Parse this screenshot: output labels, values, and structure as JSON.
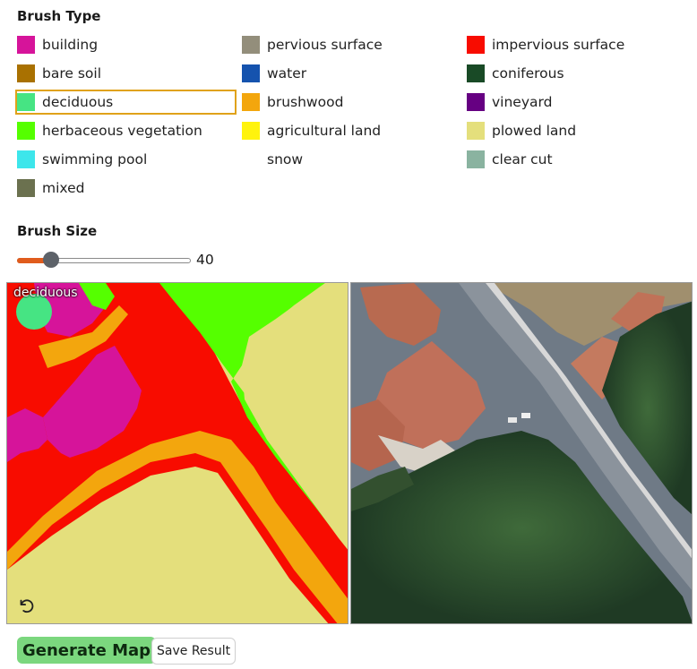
{
  "brush_type": {
    "heading": "Brush Type",
    "selected": "deciduous",
    "items": [
      {
        "label": "building",
        "color": "#d6149a"
      },
      {
        "label": "pervious surface",
        "color": "#938e7b"
      },
      {
        "label": "impervious surface",
        "color": "#f80c00"
      },
      {
        "label": "bare soil",
        "color": "#a97101"
      },
      {
        "label": "water",
        "color": "#1553ae"
      },
      {
        "label": "coniferous",
        "color": "#194a26"
      },
      {
        "label": "deciduous",
        "color": "#46e483"
      },
      {
        "label": "brushwood",
        "color": "#f3a60d"
      },
      {
        "label": "vineyard",
        "color": "#660082"
      },
      {
        "label": "herbaceous vegetation",
        "color": "#55ff00"
      },
      {
        "label": "agricultural land",
        "color": "#fff30d"
      },
      {
        "label": "plowed land",
        "color": "#e4df7c"
      },
      {
        "label": "swimming pool",
        "color": "#3de6eb"
      },
      {
        "label": "snow",
        "color": "#ffffff"
      },
      {
        "label": "clear cut",
        "color": "#8ab3a0"
      },
      {
        "label": "mixed",
        "color": "#6b714f"
      }
    ]
  },
  "brush_size": {
    "heading": "Brush Size",
    "value": 40,
    "min": 0,
    "max": 200,
    "value_text": "40"
  },
  "canvas": {
    "brush_label": "deciduous",
    "undo_icon": "undo-icon"
  },
  "aerial_image": {
    "description_icon": "aerial-photo"
  },
  "buttons": {
    "generate": "Generate Map",
    "save": "Save Result"
  }
}
